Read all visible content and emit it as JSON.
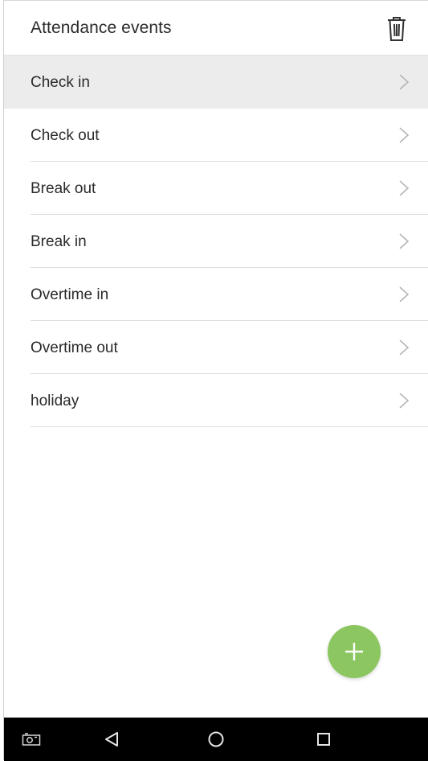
{
  "header": {
    "title": "Attendance events",
    "delete_icon": "trash-icon"
  },
  "events": [
    {
      "label": "Check in",
      "selected": true
    },
    {
      "label": "Check out",
      "selected": false
    },
    {
      "label": "Break out",
      "selected": false
    },
    {
      "label": "Break in",
      "selected": false
    },
    {
      "label": "Overtime in",
      "selected": false
    },
    {
      "label": "Overtime out",
      "selected": false
    },
    {
      "label": "holiday",
      "selected": false
    }
  ],
  "fab": {
    "icon": "plus-icon",
    "color": "#8cc660"
  },
  "navbar": {
    "icons": [
      "screenshot-icon",
      "back-icon",
      "home-icon",
      "recents-icon"
    ]
  },
  "colors": {
    "selected_row": "#ececec",
    "divider": "#dcdcdc",
    "chevron": "#b5b5b5",
    "navbar": "#000000"
  }
}
